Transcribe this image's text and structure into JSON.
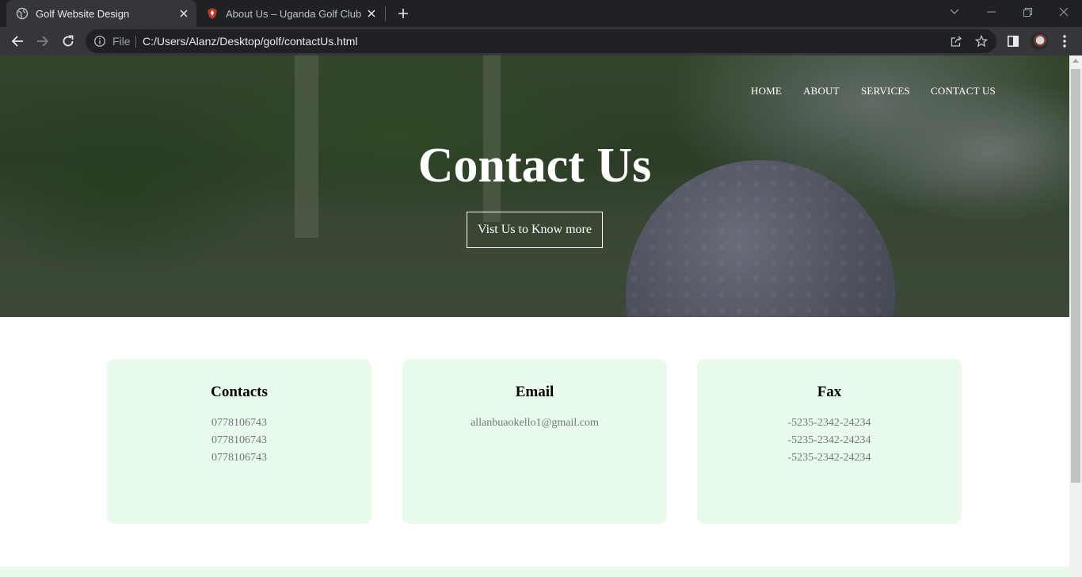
{
  "browser": {
    "tabs": [
      {
        "title": "Golf Website Design",
        "active": true
      },
      {
        "title": "About Us – Uganda Golf Club",
        "active": false
      }
    ],
    "address": {
      "scheme_label": "File",
      "url": "C:/Users/Alanz/Desktop/golf/contactUs.html"
    }
  },
  "nav": {
    "items": [
      "HOME",
      "ABOUT",
      "SERVICES",
      "CONTACT US"
    ]
  },
  "hero": {
    "title": "Contact Us",
    "button_label": "Vist Us to Know more"
  },
  "cards": [
    {
      "title": "Contacts",
      "lines": [
        "0778106743",
        "0778106743",
        "0778106743"
      ]
    },
    {
      "title": "Email",
      "lines": [
        "allanbuaokello1@gmail.com"
      ]
    },
    {
      "title": "Fax",
      "lines": [
        "-5235-2342-24234",
        "-5235-2342-24234",
        "-5235-2342-24234"
      ]
    }
  ],
  "colors": {
    "card_bg": "#e8fbeb",
    "chrome_dark": "#202124",
    "chrome_toolbar": "#35363a"
  },
  "icons": [
    "globe-icon",
    "club-crest-icon",
    "close-icon",
    "new-tab-icon",
    "chevron-down-icon",
    "minimize-icon",
    "restore-icon",
    "window-close-icon",
    "back-icon",
    "forward-icon",
    "reload-icon",
    "info-icon",
    "share-icon",
    "star-icon",
    "side-panel-icon",
    "profile-avatar",
    "more-menu-icon"
  ]
}
